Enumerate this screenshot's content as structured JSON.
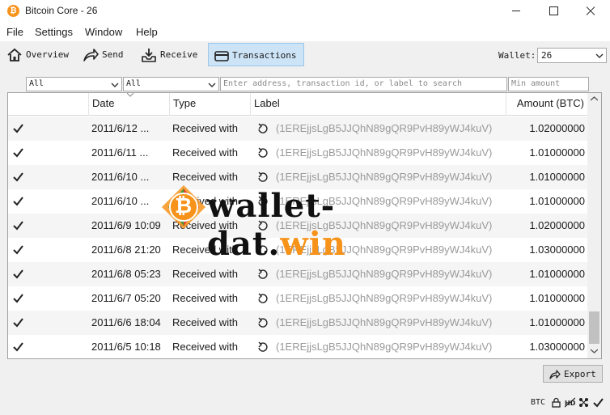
{
  "window": {
    "title": "Bitcoin Core - 26",
    "app_icon_glyph": "₿"
  },
  "menu": {
    "items": [
      "File",
      "Settings",
      "Window",
      "Help"
    ]
  },
  "toolbar": {
    "buttons": [
      {
        "label": "Overview",
        "icon": "home-icon"
      },
      {
        "label": "Send",
        "icon": "send-icon"
      },
      {
        "label": "Receive",
        "icon": "receive-icon"
      },
      {
        "label": "Transactions",
        "icon": "transactions-icon",
        "active": true
      }
    ],
    "wallet_label": "Wallet:",
    "wallet_value": "26"
  },
  "filters": {
    "date_value": "All",
    "type_value": "All",
    "search_placeholder": "Enter address, transaction id, or label to search",
    "min_amount_placeholder": "Min amount"
  },
  "table": {
    "columns": [
      "Date",
      "Type",
      "Label",
      "Amount (BTC)"
    ],
    "rows": [
      {
        "date": "2011/6/12 ...",
        "type": "Received with",
        "label": "(1EREjjsLgB5JJQhN89gQR9PvH89yWJ4kuV)",
        "amount": "1.02000000"
      },
      {
        "date": "2011/6/11 ...",
        "type": "Received with",
        "label": "(1EREjjsLgB5JJQhN89gQR9PvH89yWJ4kuV)",
        "amount": "1.01000000"
      },
      {
        "date": "2011/6/10 ...",
        "type": "Received with",
        "label": "(1EREjjsLgB5JJQhN89gQR9PvH89yWJ4kuV)",
        "amount": "1.01000000"
      },
      {
        "date": "2011/6/10 ...",
        "type": "Received with",
        "label": "(1EREjjsLgB5JJQhN89gQR9PvH89yWJ4kuV)",
        "amount": "1.01000000"
      },
      {
        "date": "2011/6/9 10:09",
        "type": "Received with",
        "label": "(1EREjjsLgB5JJQhN89gQR9PvH89yWJ4kuV)",
        "amount": "1.02000000"
      },
      {
        "date": "2011/6/8 21:20",
        "type": "Received with",
        "label": "(1EREjjsLgB5JJQhN89gQR9PvH89yWJ4kuV)",
        "amount": "1.03000000"
      },
      {
        "date": "2011/6/8 05:23",
        "type": "Received with",
        "label": "(1EREjjsLgB5JJQhN89gQR9PvH89yWJ4kuV)",
        "amount": "1.01000000"
      },
      {
        "date": "2011/6/7 05:20",
        "type": "Received with",
        "label": "(1EREjjsLgB5JJQhN89gQR9PvH89yWJ4kuV)",
        "amount": "1.01000000"
      },
      {
        "date": "2011/6/6 18:04",
        "type": "Received with",
        "label": "(1EREjjsLgB5JJQhN89gQR9PvH89yWJ4kuV)",
        "amount": "1.01000000"
      },
      {
        "date": "2011/6/5 10:18",
        "type": "Received with",
        "label": "(1EREjjsLgB5JJQhN89gQR9PvH89yWJ4kuV)",
        "amount": "1.03000000"
      }
    ]
  },
  "watermark": {
    "part1": "wallet-dat.",
    "part2": "win",
    "coin_glyph": "₿",
    "color_dark": "#111111",
    "color_accent": "#f7931a"
  },
  "export_label": "Export",
  "status": {
    "unit": "BTC"
  },
  "colors": {
    "accent": "#f7931a",
    "active_tab": "#cde4f7",
    "address_text": "#9a9a9a"
  }
}
